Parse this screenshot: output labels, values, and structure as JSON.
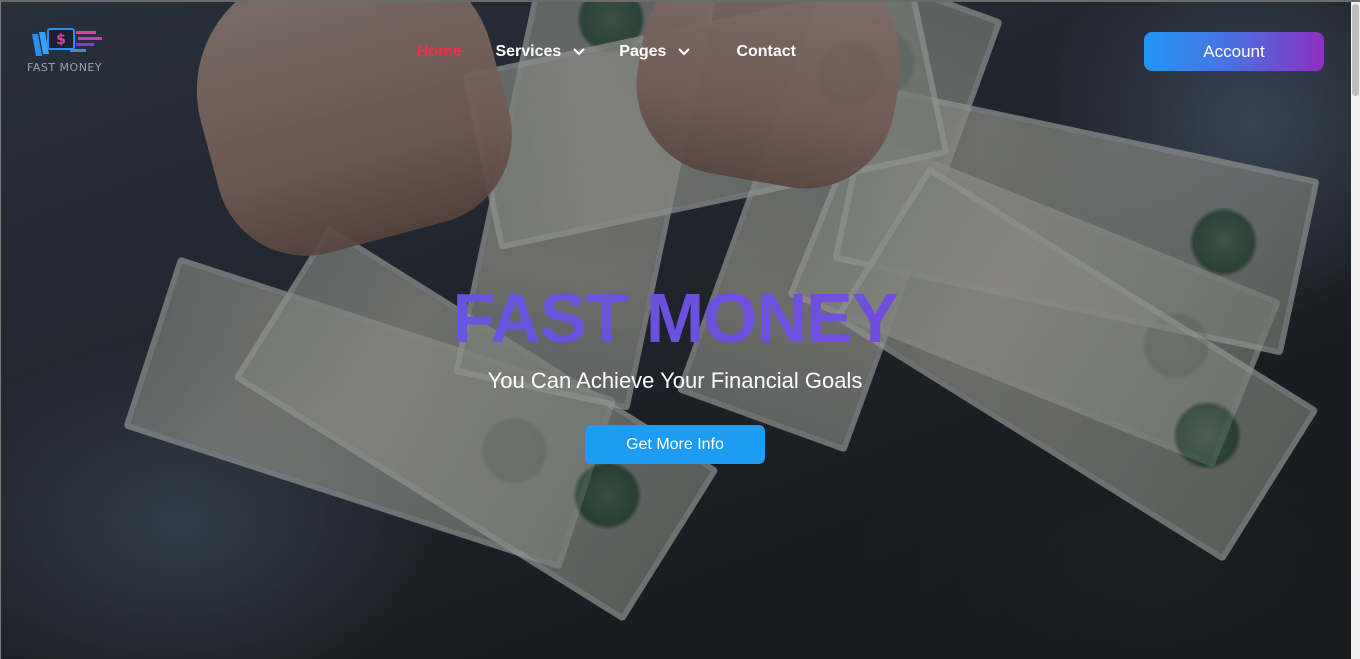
{
  "brand": {
    "name": "FAST MONEY",
    "logo_icon": "money-stack-logo-icon",
    "colors": {
      "pink": "#e040a0",
      "blue": "#2a8ff0",
      "purple": "#7a3fd6"
    }
  },
  "nav": {
    "items": [
      {
        "label": "Home",
        "active": true,
        "has_dropdown": false
      },
      {
        "label": "Services",
        "active": false,
        "has_dropdown": true
      },
      {
        "label": "Pages",
        "active": false,
        "has_dropdown": true
      },
      {
        "label": "Contact",
        "active": false,
        "has_dropdown": false
      }
    ],
    "active_color": "#ff2b43",
    "dropdown_icon": "chevron-down-icon"
  },
  "account": {
    "label": "Account",
    "gradient": [
      "#2196f3",
      "#8e2fc1"
    ]
  },
  "hero": {
    "title": "FAST MONEY",
    "subtitle": "You Can Achieve Your Financial Goals",
    "cta_label": "Get More Info",
    "cta_color": "#1e9bf2",
    "background": "hands-counting-dollar-bills-image"
  }
}
